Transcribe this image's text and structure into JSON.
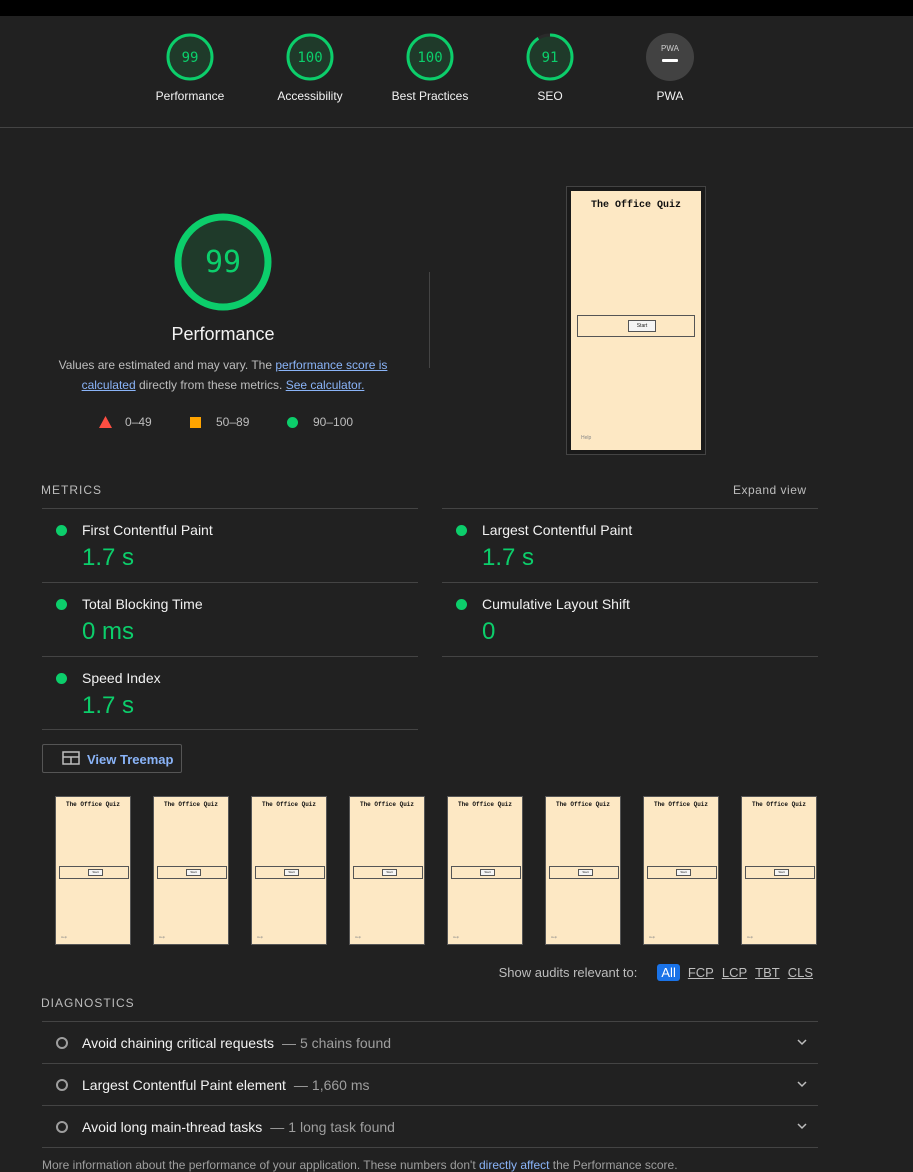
{
  "header": {
    "gauges": [
      {
        "score": "99",
        "label": "Performance"
      },
      {
        "score": "100",
        "label": "Accessibility"
      },
      {
        "score": "100",
        "label": "Best Practices"
      },
      {
        "score": "91",
        "label": "SEO"
      },
      {
        "score": "",
        "label": "PWA",
        "badge": "PWA"
      }
    ]
  },
  "performance": {
    "score": "99",
    "title": "Performance",
    "desc_prefix": "Values are estimated and may vary. The ",
    "desc_link1": "performance score is calculated",
    "desc_middle": " directly from these metrics. ",
    "desc_link2": "See calculator.",
    "legend": {
      "fail": "0–49",
      "average": "50–89",
      "pass": "90–100"
    }
  },
  "screenshot": {
    "title": "The Office Quiz",
    "start": "Start",
    "help": "Help"
  },
  "metrics": {
    "title": "METRICS",
    "expand": "Expand view",
    "items": [
      {
        "label": "First Contentful Paint",
        "value": "1.7 s"
      },
      {
        "label": "Largest Contentful Paint",
        "value": "1.7 s"
      },
      {
        "label": "Total Blocking Time",
        "value": "0 ms"
      },
      {
        "label": "Cumulative Layout Shift",
        "value": "0"
      },
      {
        "label": "Speed Index",
        "value": "1.7 s"
      }
    ]
  },
  "treemap": {
    "label": "View Treemap"
  },
  "filmstrip": {
    "count": 8,
    "title": "The Office Quiz",
    "start": "Start",
    "help": "Help"
  },
  "filter": {
    "label": "Show audits relevant to:",
    "chips": [
      "All",
      "FCP",
      "LCP",
      "TBT",
      "CLS"
    ]
  },
  "diagnostics": {
    "title": "DIAGNOSTICS",
    "items": [
      {
        "title": "Avoid chaining critical requests",
        "detail": "5 chains found"
      },
      {
        "title": "Largest Contentful Paint element",
        "detail": "1,660 ms"
      },
      {
        "title": "Avoid long main-thread tasks",
        "detail": "1 long task found"
      }
    ]
  },
  "footnote": {
    "prefix": "More information about the performance of your application. These numbers don't ",
    "link": "directly affect",
    "suffix": " the Performance score."
  },
  "colors": {
    "pass": "#0cce6b",
    "average": "#ffa400",
    "fail": "#ff4e42",
    "link": "#8ab4f8"
  }
}
